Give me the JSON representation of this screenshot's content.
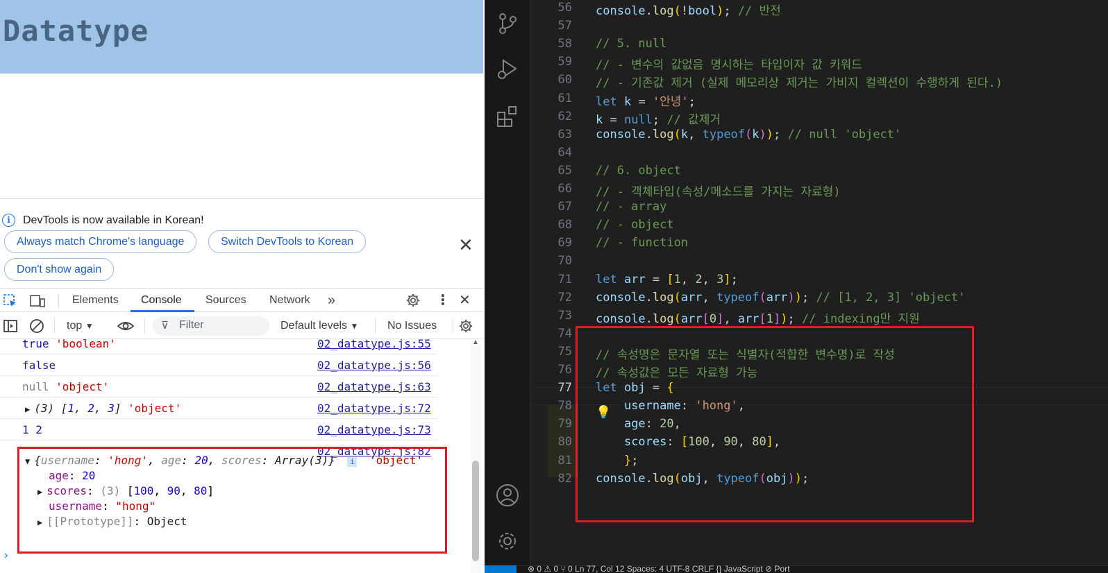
{
  "page": {
    "title": "Datatype"
  },
  "infobar": {
    "message": "DevTools is now available in Korean!",
    "buttons": [
      "Always match Chrome's language",
      "Switch DevTools to Korean",
      "Don't show again"
    ]
  },
  "devtools": {
    "tabs": [
      "Elements",
      "Console",
      "Sources",
      "Network"
    ],
    "active_tab": "Console",
    "toolbar": {
      "context": "top",
      "filter_placeholder": "Filter",
      "levels": "Default levels",
      "issues": "No Issues"
    }
  },
  "console": {
    "rows": [
      {
        "message": "true 'boolean'",
        "source": "02_datatype.js:55"
      },
      {
        "message": "false",
        "source": "02_datatype.js:56"
      },
      {
        "message": "null 'object'",
        "source": "02_datatype.js:63"
      },
      {
        "message": "(3) [1, 2, 3] 'object'",
        "source": "02_datatype.js:72"
      },
      {
        "message": "1 2",
        "source": "02_datatype.js:73"
      },
      {
        "message": "",
        "source": "02_datatype.js:82"
      }
    ],
    "object_summary": "{username: 'hong', age: 20, scores: Array(3)}",
    "object_type": "'object'",
    "object_props": [
      {
        "key": "age",
        "value": "20"
      },
      {
        "key": "scores",
        "value": "(3) [100, 90, 80]"
      },
      {
        "key": "username",
        "value": "\"hong\""
      },
      {
        "key": "[[Prototype]]",
        "value": "Object"
      }
    ]
  },
  "editor": {
    "active_line": 77,
    "lines": [
      {
        "n": 56,
        "text": "console.log(!bool); // 반전"
      },
      {
        "n": 57,
        "text": ""
      },
      {
        "n": 58,
        "text": "// 5. null"
      },
      {
        "n": 59,
        "text": "// - 변수의 값없음 명시하는 타입이자 값 키워드"
      },
      {
        "n": 60,
        "text": "// - 기존값 제거 (실제 메모리상 제거는 가비지 컬렉션이 수행하게 된다.)"
      },
      {
        "n": 61,
        "text": "let k = '안녕';"
      },
      {
        "n": 62,
        "text": "k = null; // 값제거"
      },
      {
        "n": 63,
        "text": "console.log(k, typeof(k)); // null 'object'"
      },
      {
        "n": 64,
        "text": ""
      },
      {
        "n": 65,
        "text": "// 6. object"
      },
      {
        "n": 66,
        "text": "// - 객체타입(속성/메소드를 가지는 자료형)"
      },
      {
        "n": 67,
        "text": "// - array"
      },
      {
        "n": 68,
        "text": "// - object"
      },
      {
        "n": 69,
        "text": "// - function"
      },
      {
        "n": 70,
        "text": ""
      },
      {
        "n": 71,
        "text": "let arr = [1, 2, 3];"
      },
      {
        "n": 72,
        "text": "console.log(arr, typeof(arr)); // [1, 2, 3] 'object'"
      },
      {
        "n": 73,
        "text": "console.log(arr[0], arr[1]); // indexing만 지원"
      },
      {
        "n": 74,
        "text": ""
      },
      {
        "n": 75,
        "text": "// 속성명은 문자열 또는 식별자(적합한 변수명)로 작성"
      },
      {
        "n": 76,
        "text": "// 속성값은 모든 자료형 가능"
      },
      {
        "n": 77,
        "text": "let obj = {"
      },
      {
        "n": 78,
        "text": "    username: 'hong',"
      },
      {
        "n": 79,
        "text": "    age: 20,"
      },
      {
        "n": 80,
        "text": "    scores: [100, 90, 80],"
      },
      {
        "n": 81,
        "text": "    };"
      },
      {
        "n": 82,
        "text": "console.log(obj, typeof(obj));"
      }
    ]
  },
  "statusbar": {
    "text": "⊗ 0 ⚠ 0   ⑂ 0          Ln 77, Col 12   Spaces: 4   UTF-8   CRLF   {} JavaScript   ⊘ Port"
  },
  "colors": {
    "highlight_border": "#e01b24",
    "devtools_accent": "#1a73e8",
    "page_header": "#a0c4e8",
    "editor_bg": "#1f1f1f"
  }
}
